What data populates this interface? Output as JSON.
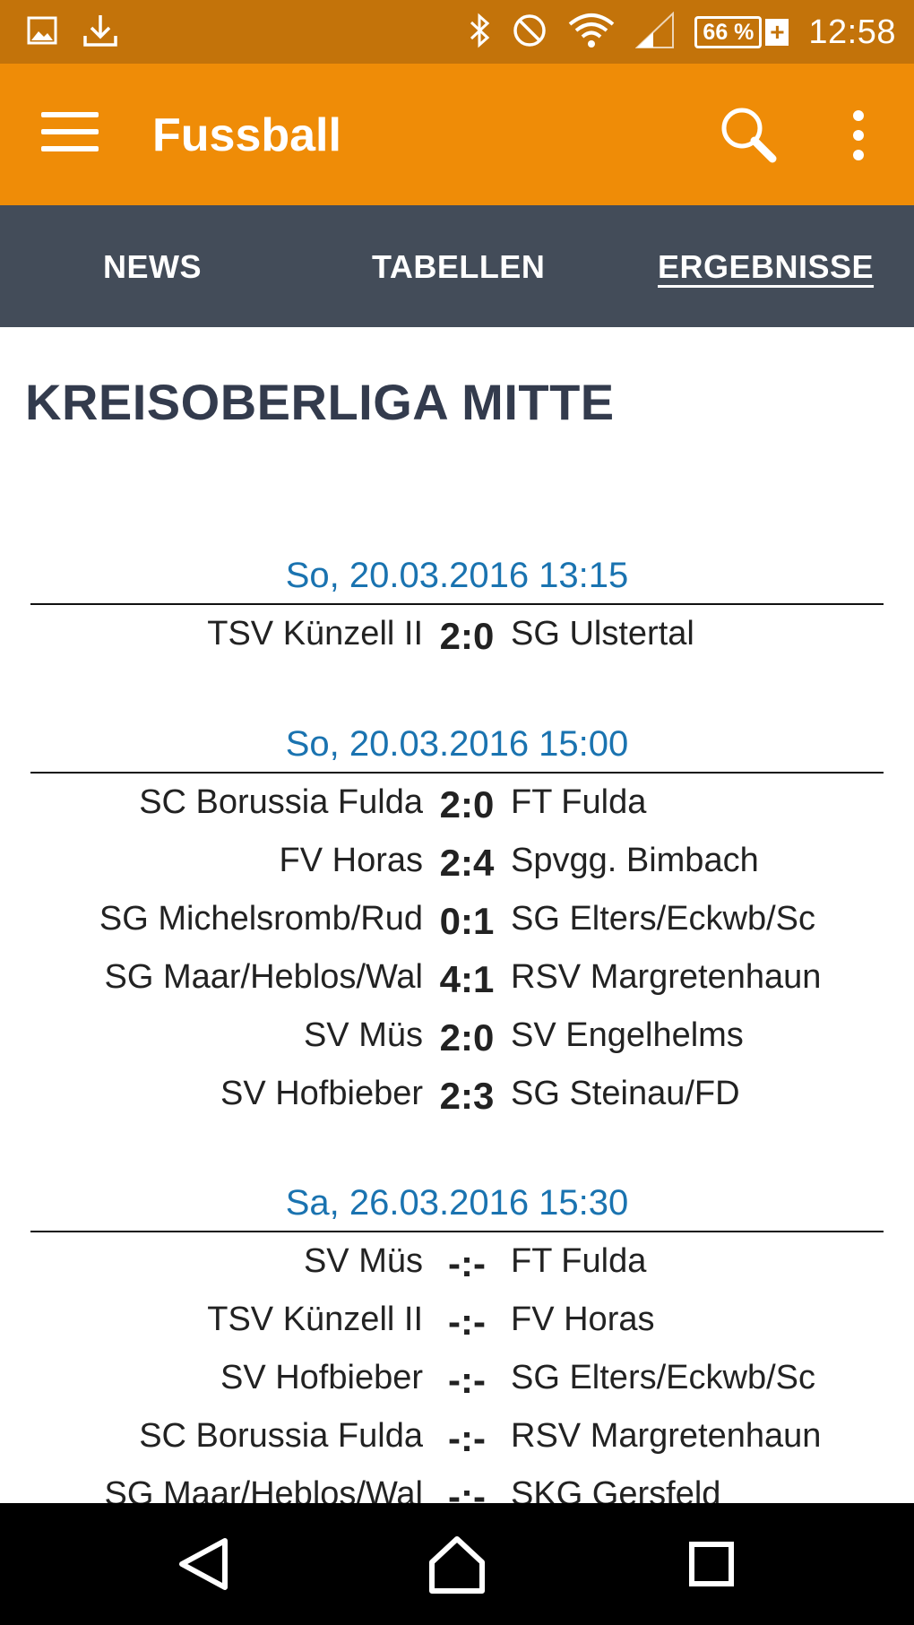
{
  "status_bar": {
    "clock": "12:58",
    "battery": "66 %",
    "battery_plus": "+",
    "icons": [
      "image-icon",
      "download-icon",
      "bluetooth-icon",
      "do-not-disturb-icon",
      "wifi-icon",
      "signal-icon",
      "battery-icon"
    ]
  },
  "app_bar": {
    "title": "Fussball",
    "icons": [
      "menu-icon",
      "search-icon",
      "more-vert-icon"
    ]
  },
  "tabs": [
    {
      "label": "NEWS",
      "active": false
    },
    {
      "label": "TABELLEN",
      "active": false
    },
    {
      "label": "ERGEBNISSE",
      "active": true
    }
  ],
  "league": "KREISOBERLIGA MITTE",
  "groups": [
    {
      "date": "So, 20.03.2016 13:15",
      "matches": [
        {
          "home": "TSV Künzell II",
          "score": "2:0",
          "away": "SG Ulstertal"
        }
      ]
    },
    {
      "date": "So, 20.03.2016 15:00",
      "matches": [
        {
          "home": "SC Borussia Fulda",
          "score": "2:0",
          "away": "FT Fulda"
        },
        {
          "home": "FV Horas",
          "score": "2:4",
          "away": "Spvgg. Bimbach"
        },
        {
          "home": "SG Michelsromb/Rud",
          "score": "0:1",
          "away": "SG Elters/Eckwb/Sc"
        },
        {
          "home": "SG Maar/Heblos/Wal",
          "score": "4:1",
          "away": "RSV Margretenhaun"
        },
        {
          "home": "SV Müs",
          "score": "2:0",
          "away": "SV Engelhelms"
        },
        {
          "home": "SV Hofbieber",
          "score": "2:3",
          "away": "SG Steinau/FD"
        }
      ]
    },
    {
      "date": "Sa, 26.03.2016 15:30",
      "matches": [
        {
          "home": "SV Müs",
          "score": "-:-",
          "away": "FT Fulda"
        },
        {
          "home": "TSV Künzell II",
          "score": "-:-",
          "away": "FV Horas"
        },
        {
          "home": "SV Hofbieber",
          "score": "-:-",
          "away": "SG Elters/Eckwb/Sc"
        },
        {
          "home": "SC Borussia Fulda",
          "score": "-:-",
          "away": "RSV Margretenhaun"
        },
        {
          "home": "SG Maar/Heblos/Wal",
          "score": "-:-",
          "away": "SKG Gersfeld"
        }
      ]
    }
  ],
  "nav_bar": {
    "icons": [
      "back-icon",
      "home-icon",
      "recents-icon"
    ]
  }
}
